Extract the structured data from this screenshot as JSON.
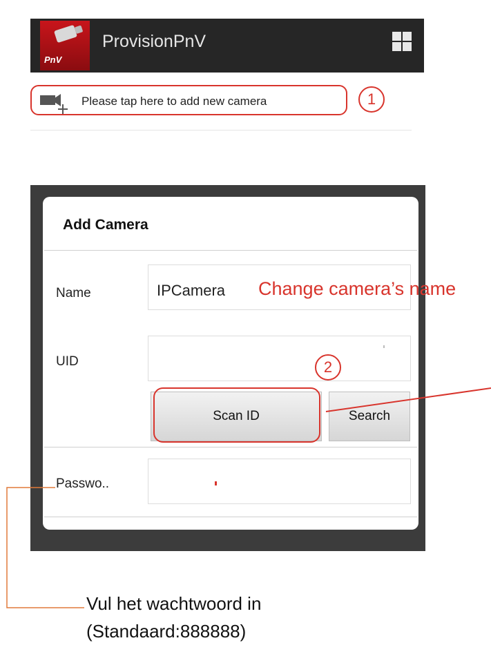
{
  "app_bar": {
    "title": "ProvisionPnV",
    "logo_text": "PnV",
    "logo_icon": "security-camera-icon",
    "menu_icon": "grid-icon"
  },
  "add_camera_row": {
    "label": "Please tap here to add new camera",
    "icon": "add-camera-icon",
    "step": "1"
  },
  "dialog": {
    "title": "Add Camera",
    "name_label": "Name",
    "name_value": "IPCamera",
    "uid_label": "UID",
    "uid_value": "",
    "scan_button": "Scan ID",
    "search_button": "Search",
    "password_label": "Passwo..",
    "password_value": ""
  },
  "annotations": {
    "step2": "2",
    "change_name": "Change camera’s name",
    "password_note_line1": "Vul het wachtwoord in",
    "password_note_line2": "(Standaard:888888)"
  },
  "colors": {
    "accent_red": "#d8342c",
    "app_bar": "#262626",
    "dialog_frame": "#3c3c3c"
  }
}
